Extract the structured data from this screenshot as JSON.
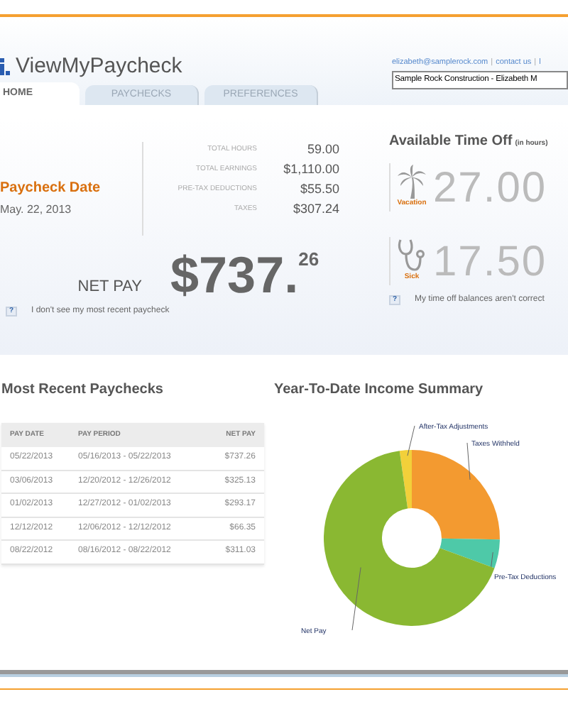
{
  "header": {
    "logo_text": "ViewMyPaycheck",
    "links": [
      "elizabeth@samplerock.com",
      "contact us",
      "l"
    ],
    "link_separator": "|",
    "company_select": "Sample Rock Construction - Elizabeth M"
  },
  "tabs": [
    {
      "label": "HOME",
      "selected": true
    },
    {
      "label": "PAYCHECKS",
      "selected": false
    },
    {
      "label": "PREFERENCES",
      "selected": false
    }
  ],
  "paycheck": {
    "title": "Paycheck Date",
    "date": "May. 22, 2013",
    "stats": [
      {
        "label": "TOTAL HOURS",
        "value": "59.00"
      },
      {
        "label": "TOTAL EARNINGS",
        "value": "$1,110.00"
      },
      {
        "label": "PRE-TAX DEDUCTIONS",
        "value": "$55.50"
      },
      {
        "label": "TAXES",
        "value": "$307.24"
      }
    ],
    "net_pay_label": "NET PAY",
    "net_pay_amount": "$737.",
    "net_pay_cents": "26",
    "help_mark": "?",
    "help": "I don't see my most recent paycheck"
  },
  "time_off": {
    "title": "Available Time Off",
    "unit": "(in hours)",
    "balances": [
      {
        "kind": "vacation",
        "label": "Vacation",
        "value": "27.00"
      },
      {
        "kind": "sick",
        "label": "Sick",
        "value": "17.50"
      }
    ],
    "help_mark": "?",
    "help": "My time off balances aren't correct"
  },
  "recent_paychecks": {
    "title": "Most Recent Paychecks",
    "columns": [
      "PAY DATE",
      "PAY PERIOD",
      "NET PAY"
    ],
    "rows": [
      [
        "05/22/2013",
        "05/16/2013 - 05/22/2013",
        "$737.26"
      ],
      [
        "03/06/2013",
        "12/20/2012 - 12/26/2012",
        "$325.13"
      ],
      [
        "01/02/2013",
        "12/27/2012 - 01/02/2013",
        "$293.17"
      ],
      [
        "12/12/2012",
        "12/06/2012 - 12/12/2012",
        "$66.35"
      ],
      [
        "08/22/2012",
        "08/16/2012 - 08/22/2012",
        "$311.03"
      ]
    ]
  },
  "ytd_summary": {
    "title": "Year-To-Date Income Summary",
    "slices": [
      {
        "label": "After-Tax Adjustments",
        "color": "#f2d03a"
      },
      {
        "label": "Taxes Withheld",
        "color": "#f39a30"
      },
      {
        "label": "Pre-Tax Deductions",
        "color": "#4ec9a8"
      },
      {
        "label": "Net Pay",
        "color": "#8ab832"
      }
    ]
  }
}
